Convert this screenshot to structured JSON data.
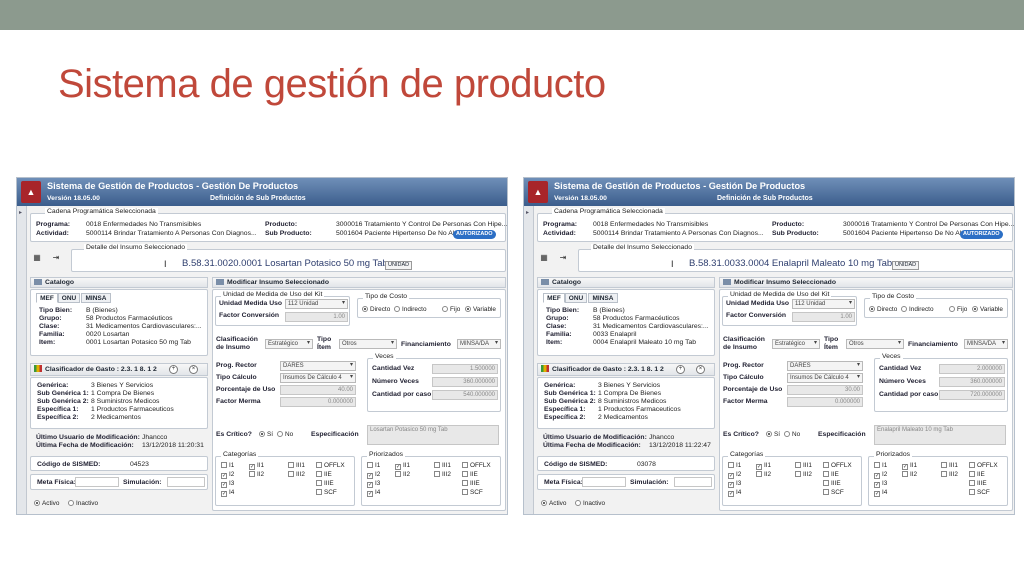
{
  "slide": {
    "title": "Sistema de gestión de producto"
  },
  "colors": {
    "title": "#c0483a",
    "topbar": "#8c9a8e",
    "header": "#3b5d8c",
    "badge": "#2c6fc5"
  },
  "common": {
    "app_title": "Sistema de Gestión de Productos - Gestión De Productos",
    "version": "Versión 18.05.00",
    "module": "Definición de Sub Productos",
    "logo_icon": "shield-logo-icon",
    "nav_icon": "expand-arrow-icon",
    "prog_legend": "Cadena Programática Seleccionada",
    "programa_label": "Programa:",
    "programa": "0018 Enfermedades No Transmisibles",
    "actividad_label": "Actividad:",
    "actividad": "5000114 Brindar Tratamiento A Personas Con Diagnos...",
    "producto_label": "Producto:",
    "producto": "3000016 Tratamiento Y Control De Personas Con Hipe...",
    "subproducto_label": "Sub Producto:",
    "subproducto": "5001604 Paciente Hipertenso De No Al...",
    "badge": "AUTORIZADO",
    "insumo_legend": "Detalle del Insumo Seleccionado",
    "catalogo_title": "Catalogo",
    "tabs": [
      "MEF",
      "ONU",
      "MINSA"
    ],
    "tipo_bien_label": "Tipo Bien:",
    "tipo_bien": "B (Bienes)",
    "grupo_label": "Grupo:",
    "grupo": "58 Productos Farmacéuticos",
    "clase_label": "Clase:",
    "clase": "31 Medicamentos Cardiovasculares:...",
    "familia_label": "Familia:",
    "item_label": "Item:",
    "clasif_title": "Clasificador de Gasto : 2.3. 1 8. 1 2",
    "generica_label": "Genérica:",
    "generica": "3 Bienes Y Servicios",
    "subgen1_label": "Sub Genérica 1:",
    "subgen1": "1 Compra De Bienes",
    "subgen2_label": "Sub Genérica 2:",
    "subgen2": "8 Suministros Medicos",
    "esp1_label": "Específica 1:",
    "esp1": "1 Productos Farmaceuticos",
    "esp2_label": "Específica 2:",
    "esp2": "2 Medicamentos",
    "ultimo_usuario_label": "Último Usuario de Modificación:",
    "ultimo_usuario": "Jhancco",
    "ultima_fecha_label": "Última Fecha de Modificación:",
    "sismed_label": "Código de SISMED:",
    "meta_label": "Meta Física:",
    "simulacion_label": "Simulación:",
    "activo": "Activo",
    "inactivo": "Inactivo",
    "modificar_title": "Modificar Insumo Seleccionado",
    "unidad_legend": "Unidad de Medida de Uso del Kit",
    "unidad_medida_label": "Unidad Medida Uso",
    "unidad_medida": "112 Unidad",
    "factor_conv_label": "Factor Conversión",
    "factor_conv": "1.00",
    "tipo_costo_legend": "Tipo de Costo",
    "directo": "Directo",
    "indirecto": "Indirecto",
    "fijo": "Fijo",
    "variable": "Variable",
    "clasif_insumo_label": "Clasificación de Insumo",
    "clasif_insumo": "Estratégico",
    "tipo_item_label": "Tipo Ítem",
    "tipo_item": "Otros",
    "financiamiento_label": "Financiamiento",
    "financiamiento": "MINSA/DA",
    "prog_rector_label": "Prog. Rector",
    "prog_rector": "DARES",
    "tipo_calculo_label": "Tipo Cálculo",
    "tipo_calculo": "Insumos De Cálculo 4",
    "porcentaje_label": "Porcentaje de Uso",
    "factor_merma_label": "Factor Merma",
    "veces_legend": "Veces",
    "cantidad_vez_label": "Cantidad Vez",
    "numero_veces_label": "Número Veces",
    "cantidad_caso_label": "Cantidad por caso",
    "critico_label": "Es Crítico?",
    "si": "Sí",
    "no": "No",
    "especificacion_label": "Especificación",
    "categorias_legend": "Categorías",
    "priorizados_legend": "Priorizados",
    "checks": [
      "I1",
      "II1",
      "III1",
      "OFFLX",
      "I2",
      "II2",
      "III2",
      "IIE",
      "I3",
      "IIIE",
      "I4",
      "SCF"
    ],
    "icons": [
      "doc-icon",
      "exit-icon",
      "add-circle-icon",
      "remove-circle-icon"
    ]
  },
  "left": {
    "codigo": "B.58.31.0020.0001 Losartan Potasico 50 mg Tab",
    "unidad_btn": "UNIDAD",
    "familia": "0020 Losartan",
    "item": "0001 Losartan Potasico 50 mg Tab",
    "ultima_fecha": "13/12/2018 11:20:31",
    "sismed": "04523",
    "porcentaje": "40.00",
    "factor_merma": "0.000000",
    "cantidad_vez": "1.500000",
    "numero_veces": "360.000000",
    "cantidad_caso": "540.000000",
    "especificacion": "Losartan Potasico 50 mg Tab"
  },
  "right": {
    "codigo": "B.58.31.0033.0004 Enalapril Maleato 10 mg Tab",
    "unidad_btn": "UNIDAD",
    "familia": "0033 Enalapril",
    "item": "0004 Enalapril Maleato 10 mg Tab",
    "ultima_fecha": "13/12/2018 11:22:47",
    "sismed": "03078",
    "porcentaje": "30.00",
    "factor_merma": "0.000000",
    "cantidad_vez": "2.000000",
    "numero_veces": "360.000000",
    "cantidad_caso": "720.000000",
    "especificacion": "Enalapril Maleato 10 mg Tab"
  }
}
